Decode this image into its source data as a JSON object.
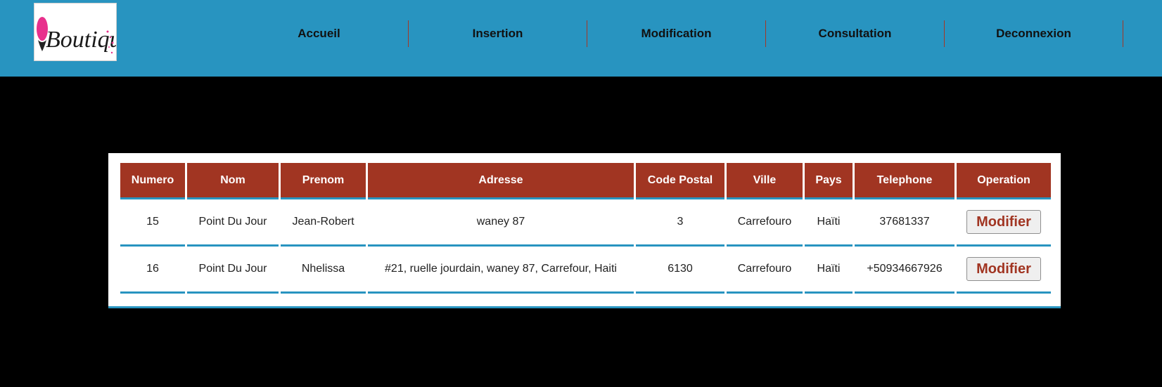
{
  "logo": {
    "text": "Boutique",
    "accent_color": "#e8308c"
  },
  "nav": {
    "items": [
      {
        "label": "Accueil"
      },
      {
        "label": "Insertion"
      },
      {
        "label": "Modification"
      },
      {
        "label": "Consultation"
      },
      {
        "label": "Deconnexion"
      }
    ]
  },
  "table": {
    "columns": [
      "Numero",
      "Nom",
      "Prenom",
      "Adresse",
      "Code Postal",
      "Ville",
      "Pays",
      "Telephone",
      "Operation"
    ],
    "rows": [
      {
        "numero": "15",
        "nom": "Point Du Jour",
        "prenom": "Jean-Robert",
        "adresse": "waney 87",
        "code_postal": "3",
        "ville": "Carrefouro",
        "pays": "Haïti",
        "telephone": "37681337",
        "operation": "Modifier"
      },
      {
        "numero": "16",
        "nom": "Point Du Jour",
        "prenom": "Nhelissa",
        "adresse": "#21, ruelle jourdain, waney 87, Carrefour, Haiti",
        "code_postal": "6130",
        "ville": "Carrefouro",
        "pays": "Haïti",
        "telephone": "+50934667926",
        "operation": "Modifier"
      }
    ]
  },
  "colors": {
    "header_bg": "#2894c0",
    "table_header_bg": "#a13522",
    "page_bg": "#000000",
    "row_border": "#2894c0"
  }
}
